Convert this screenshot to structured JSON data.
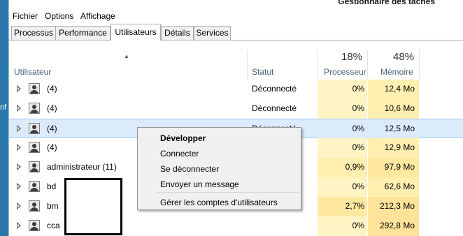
{
  "desktop": {
    "fragment_text": "nf"
  },
  "window": {
    "title": "Gestionnaire des tâches"
  },
  "menu": [
    "Fichier",
    "Options",
    "Affichage"
  ],
  "tabs": [
    {
      "label": "Processus",
      "active": false
    },
    {
      "label": "Performance",
      "active": false
    },
    {
      "label": "Utilisateurs",
      "active": true
    },
    {
      "label": "Détails",
      "active": false
    },
    {
      "label": "Services",
      "active": false
    }
  ],
  "table": {
    "columns": {
      "user": "Utilisateur",
      "status": "Statut",
      "cpu": {
        "label": "Processeur",
        "percent": "18%"
      },
      "memory": {
        "label": "Mémoire",
        "percent": "48%"
      }
    },
    "rows": [
      {
        "name": "(4)",
        "status": "Déconnecté",
        "cpu": "0%",
        "memory": "12,4 Mo",
        "cpu_color": "#fff4c4",
        "mem_color": "#ffefb0"
      },
      {
        "name": "(4)",
        "status": "Déconnecté",
        "cpu": "0%",
        "memory": "10,6 Mo",
        "cpu_color": "#fff4c4",
        "mem_color": "#ffefb0"
      },
      {
        "name": "(4)",
        "status": "Déconnecté",
        "cpu": "0%",
        "memory": "12,5 Mo",
        "cpu_color": "#dcebfc",
        "mem_color": "#dcebfc",
        "selected": true
      },
      {
        "name": "(4)",
        "status": "",
        "cpu": "0%",
        "memory": "12,9 Mo",
        "cpu_color": "#fff4c4",
        "mem_color": "#ffefb0"
      },
      {
        "name": "administrateur (11)",
        "status": "",
        "cpu": "0,9%",
        "memory": "97,9 Mo",
        "cpu_color": "#ffefb0",
        "mem_color": "#ffe9a0"
      },
      {
        "name": "bd",
        "status": "",
        "cpu": "0%",
        "memory": "62,6 Mo",
        "cpu_color": "#fff4c4",
        "mem_color": "#ffefb0"
      },
      {
        "name": "bm",
        "status": "",
        "cpu": "2,7%",
        "memory": "212,3 Mo",
        "cpu_color": "#ffe9a0",
        "mem_color": "#ffe39a"
      },
      {
        "name": "cca",
        "status": "",
        "cpu": "0%",
        "memory": "292,8 Mo",
        "cpu_color": "#fff4c4",
        "mem_color": "#ffe39a"
      }
    ]
  },
  "context_menu": {
    "items": [
      "Développer",
      "Connecter",
      "Se déconnecter",
      "Envoyer un message",
      "Gérer les comptes d'utilisateurs"
    ]
  }
}
